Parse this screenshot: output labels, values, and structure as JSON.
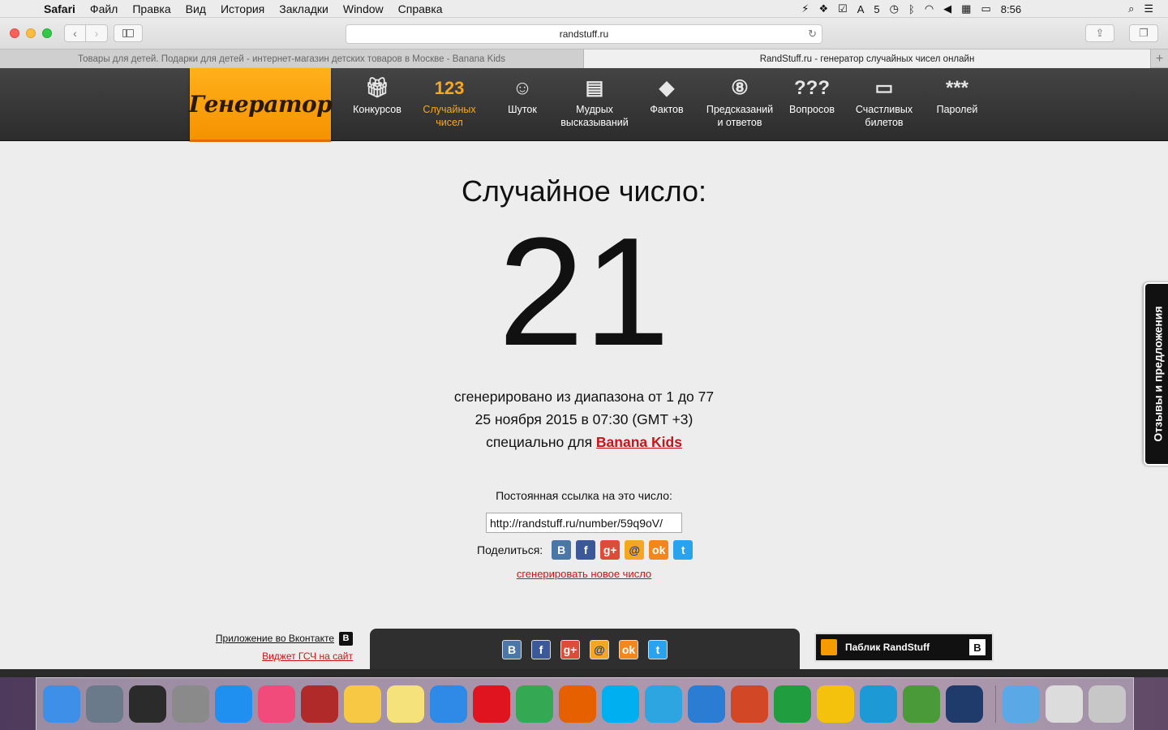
{
  "menubar": {
    "app": "Safari",
    "items": [
      "Файл",
      "Правка",
      "Вид",
      "История",
      "Закладки",
      "Window",
      "Справка"
    ],
    "notification_count": "5",
    "time": "8:56"
  },
  "browser": {
    "url": "randstuff.ru",
    "tabs": [
      {
        "title": "Товары для детей. Подарки для детей - интернет-магазин детских товаров в Москве - Banana Kids"
      },
      {
        "title": "RandStuff.ru - генератор случайных чисел онлайн"
      }
    ]
  },
  "site": {
    "logo": "Генератор",
    "nav": [
      {
        "icon": "gift-icon",
        "glyph": "🎁︎",
        "label": "Конкурсов"
      },
      {
        "icon": "numbers-icon",
        "glyph": "123",
        "label": "Случайных чисел"
      },
      {
        "icon": "smiley-icon",
        "glyph": "☺",
        "label": "Шуток"
      },
      {
        "icon": "quote-icon",
        "glyph": "▤",
        "label": "Мудрых высказываний"
      },
      {
        "icon": "exclamation-icon",
        "glyph": "◆",
        "label": "Фактов"
      },
      {
        "icon": "eightball-icon",
        "glyph": "⑧",
        "label": "Предсказаний и ответов"
      },
      {
        "icon": "question-icon",
        "glyph": "???",
        "label": "Вопросов"
      },
      {
        "icon": "ticket-icon",
        "glyph": "▭",
        "label": "Счастливых билетов"
      },
      {
        "icon": "asterisk-icon",
        "glyph": "***",
        "label": "Паролей"
      }
    ]
  },
  "result": {
    "title": "Случайное число:",
    "number": "21",
    "range_text": "сгенерировано из диапазона от 1 до 77",
    "date_text": "25 ноября 2015 в 07:30 (GMT +3)",
    "for_text": "специально для",
    "for_link": "Banana Kids",
    "permalink_label": "Постоянная ссылка на это число:",
    "permalink_value": "http://randstuff.ru/number/59q9oV/",
    "share_label": "Поделиться:",
    "regenerate": "сгенерировать новое число"
  },
  "feedback": "Отзывы и предложения",
  "footer": {
    "vk_app": "Приложение во Вконтакте",
    "widget": "Виджет ГСЧ на сайт",
    "public": "Паблик RandStuff"
  },
  "share_icons": [
    {
      "name": "vk",
      "glyph": "В"
    },
    {
      "name": "facebook",
      "glyph": "f"
    },
    {
      "name": "google-plus",
      "glyph": "g+"
    },
    {
      "name": "mail",
      "glyph": "@"
    },
    {
      "name": "odnoklassniki",
      "glyph": "ok"
    },
    {
      "name": "twitter",
      "glyph": "t"
    }
  ],
  "dock": [
    {
      "name": "finder",
      "color": "#3d8fe8"
    },
    {
      "name": "launchpad",
      "color": "#6b7a8a"
    },
    {
      "name": "dashboard",
      "color": "#2b2b2b"
    },
    {
      "name": "system-preferences",
      "color": "#8a8a8a"
    },
    {
      "name": "app-store",
      "color": "#1f8ff0"
    },
    {
      "name": "itunes",
      "color": "#f04b7a"
    },
    {
      "name": "photo-booth",
      "color": "#b02a2a"
    },
    {
      "name": "photos",
      "color": "#f7c843"
    },
    {
      "name": "notes",
      "color": "#f5e27a"
    },
    {
      "name": "safari",
      "color": "#2e8ae6"
    },
    {
      "name": "opera",
      "color": "#e0141e"
    },
    {
      "name": "chrome",
      "color": "#34a853"
    },
    {
      "name": "firefox",
      "color": "#e66000"
    },
    {
      "name": "skype",
      "color": "#00aff0"
    },
    {
      "name": "telegram",
      "color": "#2ca5e0"
    },
    {
      "name": "word",
      "color": "#2b7cd3"
    },
    {
      "name": "powerpoint",
      "color": "#d24726"
    },
    {
      "name": "excel",
      "color": "#1f9d3f"
    },
    {
      "name": "onenote-o",
      "color": "#f4c20d"
    },
    {
      "name": "lync",
      "color": "#1d9ad6"
    },
    {
      "name": "transmission",
      "color": "#4a9a3a"
    },
    {
      "name": "photoshop",
      "color": "#1e3b6b"
    },
    {
      "name": "downloads-folder",
      "color": "#5aa9e6"
    },
    {
      "name": "scanner",
      "color": "#dcdcdc"
    },
    {
      "name": "trash",
      "color": "#c7c7c7"
    }
  ]
}
